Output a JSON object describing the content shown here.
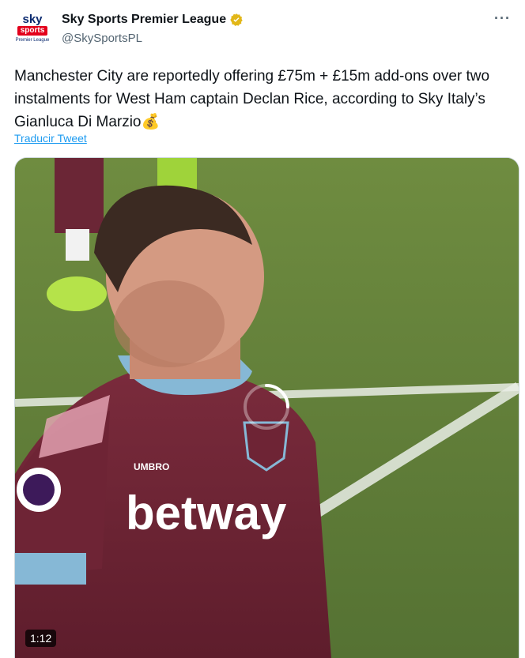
{
  "account": {
    "display_name": "Sky Sports Premier League",
    "handle": "@SkySportsPL",
    "avatar_logo_text": "sky",
    "avatar_logo_sub": "sports",
    "avatar_logo_pl": "Premier League"
  },
  "tweet": {
    "text": "Manchester City are reportedly offering £75m + £15m add-ons over two instalments for West Ham captain Declan Rice, according to Sky Italy’s Gianluca Di Marzio💰",
    "translate_label": "Traducir Tweet"
  },
  "media": {
    "sponsor_text": "betway",
    "kit_brand_text": "UMBRO",
    "duration": "1:12"
  },
  "icons": {
    "verified": "verified-badge-icon",
    "more": "more-options-icon",
    "loading": "loading-spinner-icon"
  },
  "colors": {
    "verified_gold": "#e2b719",
    "link_blue": "#1d9bf0",
    "handle_gray": "#536471"
  }
}
